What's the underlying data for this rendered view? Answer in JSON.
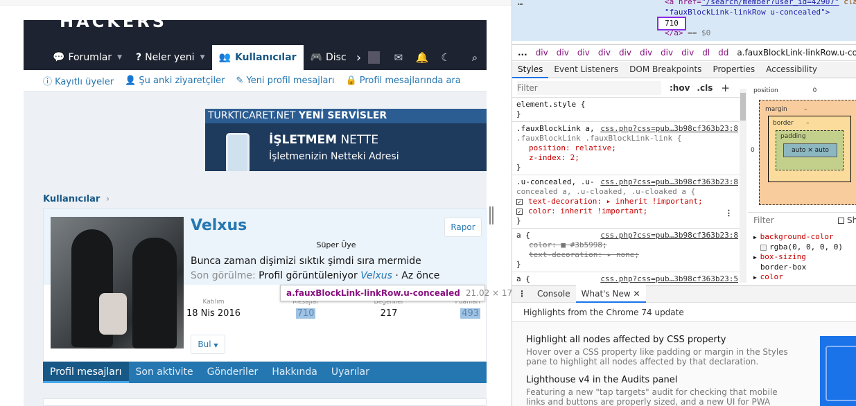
{
  "site": {
    "logo_text": "HACKERS",
    "nav": {
      "forums": "Forumlar",
      "whats_new": "Neler yeni",
      "members": "Kullanıcılar",
      "discord": "Disc"
    },
    "subnav": {
      "registered": "Kayıtlı üyeler",
      "current_visitors": "Şu anki ziyaretçiler",
      "new_profile_posts": "Yeni profil mesajları",
      "search_profile_posts": "Profil mesajlarında ara"
    },
    "banner": {
      "brand": "TURKTICARET.NET",
      "brand_suffix": "YENİ SERVİSLER",
      "title_bold": "İŞLETMEM",
      "title_rest": " NETTE",
      "subtitle": "İşletmenizin Netteki Adresi"
    },
    "breadcrumb": "Kullanıcılar",
    "profile": {
      "username": "Velxus",
      "user_title": "Süper Üye",
      "status": "Bunca zaman dişimizi sıktık şimdi sıra mermide",
      "last_seen_label": "Son görülme:",
      "last_seen_action": "Profil görüntüleniyor",
      "last_seen_link": "Velxus",
      "last_seen_time": "· Az önce",
      "report_button": "Rapor",
      "find_button": "Bul",
      "stats": [
        {
          "label": "Katılım",
          "value": "18 Nis 2016"
        },
        {
          "label": "Mesajlar",
          "value": "710"
        },
        {
          "label": "Beğeniler",
          "value": "217"
        },
        {
          "label": "Puanları",
          "value": "493"
        }
      ],
      "tabs": [
        "Profil mesajları",
        "Son aktivite",
        "Gönderiler",
        "Hakkında",
        "Uyarılar"
      ]
    },
    "tooltip": {
      "selector": "a.fauxBlockLink-linkRow.u-concealed",
      "size": "21.02 × 17"
    }
  },
  "devtools": {
    "dom": {
      "line1_tag": "<a href=",
      "line1_href": "\"/search/member?user_id=42907\"",
      "line1_attr": " cla",
      "line2": "\"fauxBlockLink-linkRow u-concealed\">",
      "selected_value": "710",
      "line4_tag": "</a>",
      "line4_eq": " == $0"
    },
    "breadcrumbs": [
      "...",
      "div",
      "div",
      "div",
      "div",
      "div",
      "div",
      "div",
      "div",
      "dl",
      "dd"
    ],
    "breadcrumb_selected": "a.fauxBlockLink-linkRow.u-concealed",
    "panel_tabs": [
      "Styles",
      "Event Listeners",
      "DOM Breakpoints",
      "Properties",
      "Accessibility"
    ],
    "filter_placeholder": "Filter",
    "hov": ":hov",
    "cls": ".cls",
    "rules": {
      "element_style": "element.style {",
      "close": "}",
      "r1_sel1": ".fauxBlockLink a,",
      "r1_src": "css.php?css=pub…3b98cf363b23:8",
      "r1_sel2": ".fauxBlockLink .fauxBlockLink-link {",
      "r1_p1": "position: relative;",
      "r1_p2": "z-index: 2;",
      "r2_sel1": ".u-concealed, .u-",
      "r2_src": "css.php?css=pub…3b98cf363b23:8",
      "r2_sel2": "concealed a, .u-cloaked, .u-cloaked a {",
      "r2_p1": "text-decoration: ▸ inherit !important;",
      "r2_p2": "color: inherit !important;",
      "r3_sel": "a {",
      "r3_src": "css.php?css=pub…3b98cf363b23:8",
      "r3_p1": "color: ■ #3b5998;",
      "r3_p2": "text-decoration: ▸ none;",
      "r4_sel": "a {",
      "r4_src": "css.php?css=pub…3b98cf363b23:5"
    },
    "boxmodel": {
      "position_label": "position",
      "position_val": "0",
      "margin_label": "margin",
      "border_label": "border",
      "padding_label": "padding",
      "dash": "–",
      "content": "auto × auto",
      "left_val": "0"
    },
    "computed": {
      "filter": "Filter",
      "show_all": "Sh",
      "p1": "background-color",
      "v1": "rgba(0, 0, 0, 0)",
      "p2": "box-sizing",
      "v2": "border-box",
      "p3": "color"
    },
    "drawer_tabs": [
      "Console",
      "What's New"
    ],
    "whats_new_heading": "Highlights from the Chrome 74 update",
    "items": [
      {
        "title": "Highlight all nodes affected by CSS property",
        "desc": "Hover over a CSS property like padding or margin in the Styles pane to highlight all nodes affected by that declaration."
      },
      {
        "title": "Lighthouse v4 in the Audits panel",
        "desc": "Featuring a new \"tap targets\" audit for checking that mobile links and buttons are properly sized, and a new UI for PWA reports."
      }
    ]
  }
}
